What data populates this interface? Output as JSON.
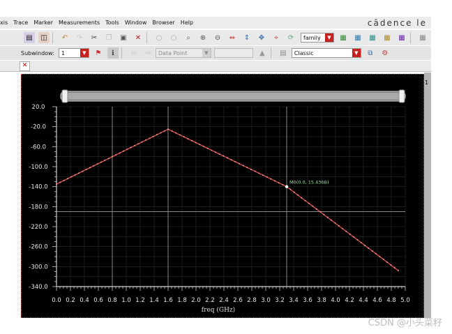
{
  "menu": {
    "items": [
      "xis",
      "Trace",
      "Marker",
      "Measurements",
      "Tools",
      "Window",
      "Browser",
      "Help"
    ],
    "brand": "cādence le"
  },
  "toolbar1": {
    "family_select": "family",
    "icons": [
      "save-icon",
      "undo-icon",
      "redo-icon",
      "cut-icon",
      "copy-icon",
      "paste-icon",
      "delete-icon",
      "zoom-fit-icon",
      "zoom-in-icon",
      "zoom-out-icon",
      "zoom-x-icon",
      "zoom-y-icon",
      "pan-icon",
      "strip-icon",
      "split-icon"
    ]
  },
  "toolbar2": {
    "subwindow_label": "Subwindow:",
    "subwindow_value": "1",
    "datapoint_placeholder": "Data Point",
    "style_select": "Classic"
  },
  "chart_data": {
    "type": "line",
    "x_range": [
      0.0,
      5.0
    ],
    "y_range": [
      -340.0,
      20.0
    ],
    "xlabel": "freq (GHz)",
    "x_ticks": [
      "0.0",
      "0.2",
      "0.4",
      "0.6",
      "0.8",
      "1.0",
      "1.2",
      "1.4",
      "1.6",
      "1.8",
      "2.0",
      "2.2",
      "2.4",
      "2.6",
      "2.8",
      "3.0",
      "3.2",
      "3.4",
      "3.6",
      "3.8",
      "4.0",
      "4.2",
      "4.4",
      "4.6",
      "4.8",
      "5.0"
    ],
    "y_ticks": [
      "20.0",
      "-20.0",
      "-60.0",
      "-100.0",
      "-140.0",
      "-180.0",
      "-220.0",
      "-260.0",
      "-300.0",
      "-340.0"
    ],
    "series": [
      {
        "color": "#e04848",
        "points": [
          [
            0.0,
            -135
          ],
          [
            1.6,
            -25
          ],
          [
            3.3,
            -140
          ],
          [
            4.9,
            -308
          ]
        ]
      }
    ],
    "marker": {
      "x": 3.3,
      "y": -140,
      "label": "M0(0.0, 15.436B)"
    },
    "grid": true,
    "major_x_lines": [
      0.8,
      1.6,
      3.3
    ],
    "major_y_lines": [
      -190
    ]
  },
  "watermark": "CSDN @小头菜籽",
  "right_panel_text": "1"
}
